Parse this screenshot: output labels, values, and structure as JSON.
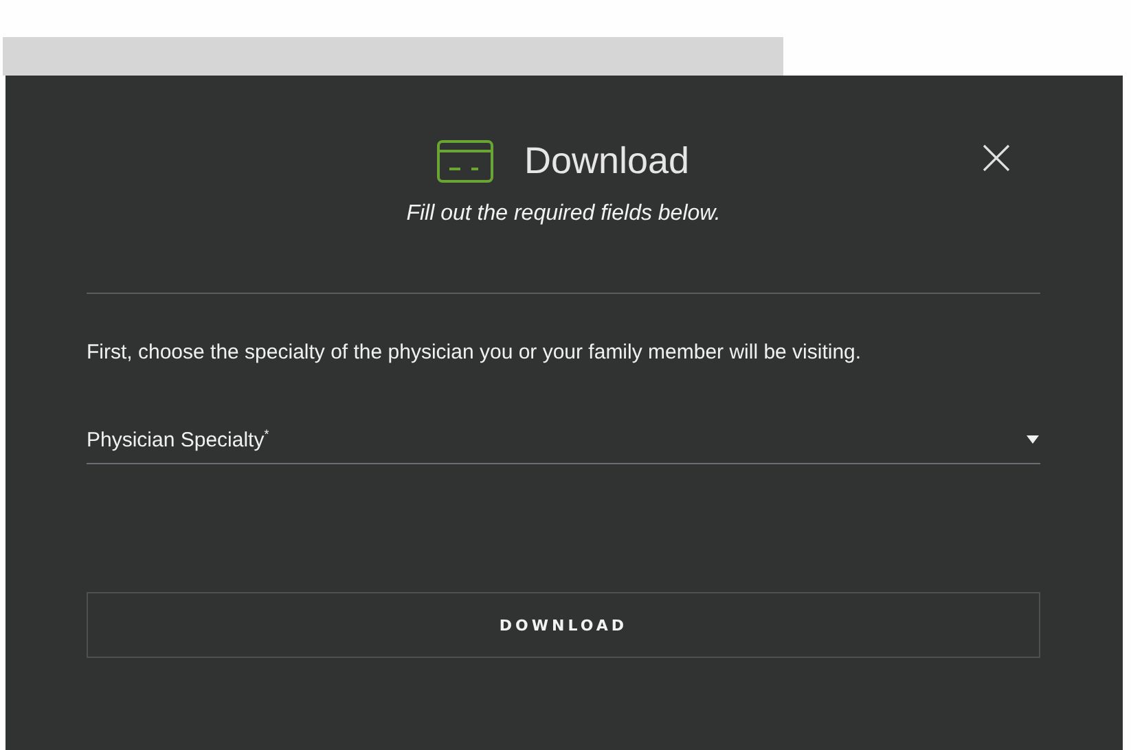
{
  "dialog": {
    "title": "Download",
    "subtitle": "Fill out the required fields below.",
    "instruction": "First, choose the specialty of the physician you or your family member will be visiting.",
    "select": {
      "label": "Physician Specialty$^{*}$"
    },
    "button": "DOWNLOAD"
  }
}
